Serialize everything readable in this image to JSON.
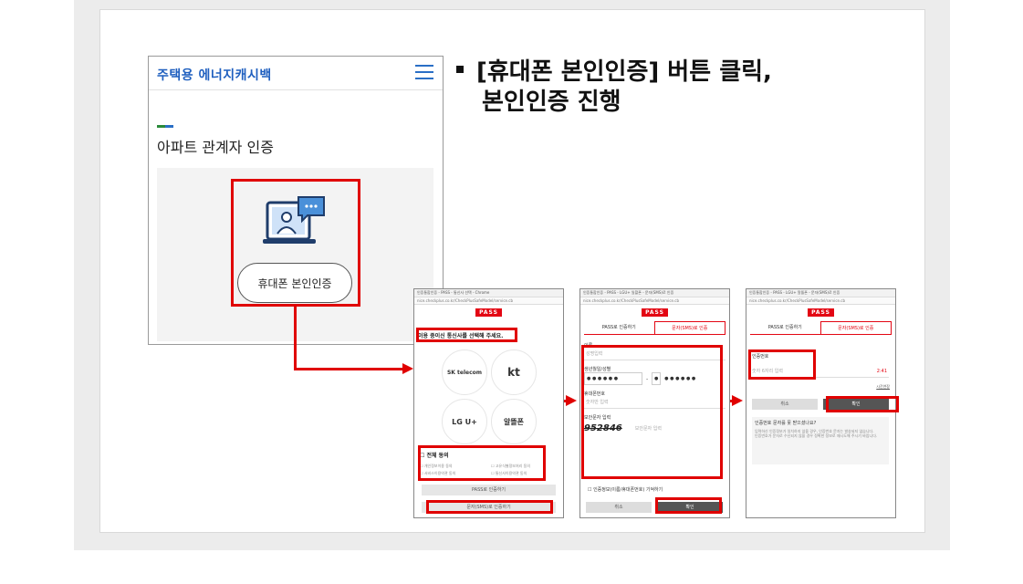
{
  "logo": "주택용 에너지캐시백",
  "page_title": "아파트 관계자 인증",
  "phone_auth_button": "휴대폰 본인인증",
  "step_text_line1": "[휴대폰 본인인증] 버튼 클릭,",
  "step_text_line2": "본인인증 진행",
  "win1": {
    "titlebar": "인증통합인증 - PASS - 통신사 선택 - Chrome",
    "url": "nice.checkplus.co.kr/CheckPlusSafeModel/service.cb",
    "pass": "PASS",
    "select_msg": "이용 중이신 통신사를 선택해 주세요.",
    "carriers": [
      "SK telecom",
      "kt",
      "LG U+",
      "알뜰폰"
    ],
    "agree_all": "전체 동의",
    "agree_items": [
      "개인정보이용 동의",
      "고유식별정보처리 동의",
      "서비스이용약관 동의",
      "통신사이용약관 동의"
    ],
    "pass_btn": "PASS로 인증하기",
    "sms_btn": "문자(SMS)로 인증하기"
  },
  "win2": {
    "titlebar": "인증통합인증 - PASS - LGU+ 일촬폰 - 문자(SMS)로 인증",
    "url": "nice.checkplus.co.kr/CheckPlusSafeModel/service.cb",
    "pass": "PASS",
    "tab_pass": "PASS로 인증하기",
    "tab_sms": "문자(SMS)로 인증",
    "name_label": "이름",
    "name_ph": "성명입력",
    "birth_label": "생년월일/성별",
    "birth_val": "● ● ● ● ● ●",
    "gender_val": "●",
    "gender_rest": "● ● ● ● ● ●",
    "phone_label": "휴대폰번호",
    "phone_ph": "숫자만 입력",
    "captcha_label": "보안문자 입력",
    "captcha": "952846",
    "captcha_ph": "보안문자 입력",
    "remember": "인증정보(이름/휴대폰번호) 기억하기",
    "cancel": "취소",
    "confirm": "확인"
  },
  "win3": {
    "titlebar": "인증통합인증 - PASS - LGU+ 알뜰폰 - 문자(SMS)로 인증",
    "url": "nice.checkplus.co.kr/CheckPlusSafeModel/service.cb",
    "pass": "PASS",
    "tab_pass": "PASS로 인증하기",
    "tab_sms": "문자(SMS)로 인증",
    "code_label": "인증번호",
    "code_ph": "숫자 6자리 입력",
    "timer": "2:41",
    "extend": "시간연장",
    "cancel": "취소",
    "confirm": "확인",
    "help_title": "인증번호 문자를 못 받으셨나요?",
    "help1": "입력하신 인증정보가 일치하지 않을 경우, 인증번호 문자는 발송되지 않습니다.",
    "help2": "인증번호가 문자로 수신되지 않을 경우 정확한 정보로 재시도해 주시기 바랍니다."
  },
  "colors": {
    "accent_red": "#e00000",
    "pass_red": "#e30613",
    "logo_blue": "#1f5fbf"
  }
}
